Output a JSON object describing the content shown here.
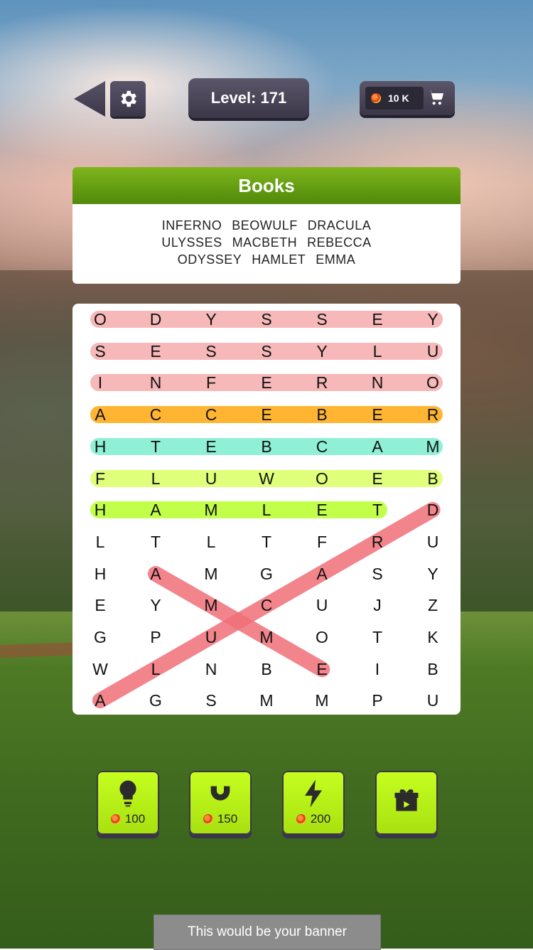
{
  "header": {
    "level_label": "Level: 171",
    "coins": "10 K"
  },
  "category": {
    "title": "Books",
    "words": [
      "INFERNO",
      "BEOWULF",
      "DRACULA",
      "ULYSSES",
      "MACBETH",
      "REBECCA",
      "ODYSSEY",
      "HAMLET",
      "EMMA"
    ]
  },
  "grid": {
    "rows": [
      [
        "O",
        "D",
        "Y",
        "S",
        "S",
        "E",
        "Y"
      ],
      [
        "S",
        "E",
        "S",
        "S",
        "Y",
        "L",
        "U"
      ],
      [
        "I",
        "N",
        "F",
        "E",
        "R",
        "N",
        "O"
      ],
      [
        "A",
        "C",
        "C",
        "E",
        "B",
        "E",
        "R"
      ],
      [
        "H",
        "T",
        "E",
        "B",
        "C",
        "A",
        "M"
      ],
      [
        "F",
        "L",
        "U",
        "W",
        "O",
        "E",
        "B"
      ],
      [
        "H",
        "A",
        "M",
        "L",
        "E",
        "T",
        "D"
      ],
      [
        "L",
        "T",
        "L",
        "T",
        "F",
        "R",
        "U"
      ],
      [
        "H",
        "A",
        "M",
        "G",
        "A",
        "S",
        "Y"
      ],
      [
        "E",
        "Y",
        "M",
        "C",
        "U",
        "J",
        "Z"
      ],
      [
        "G",
        "P",
        "U",
        "M",
        "O",
        "T",
        "K"
      ],
      [
        "W",
        "L",
        "N",
        "B",
        "E",
        "I",
        "B"
      ],
      [
        "A",
        "G",
        "S",
        "M",
        "M",
        "P",
        "U"
      ]
    ],
    "found_colors": [
      "#f6b8b8",
      "#f6b8b8",
      "#f6b8b8",
      "#ffb531",
      "#8ff0d6",
      "#e0ff7a",
      "#c2ff4a"
    ]
  },
  "powerups": [
    {
      "icon": "lightbulb-icon",
      "cost": "100"
    },
    {
      "icon": "magnet-icon",
      "cost": "150"
    },
    {
      "icon": "lightning-icon",
      "cost": "200"
    },
    {
      "icon": "gift-video-icon",
      "cost": ""
    }
  ],
  "banner": {
    "text": "This would be your banner"
  }
}
